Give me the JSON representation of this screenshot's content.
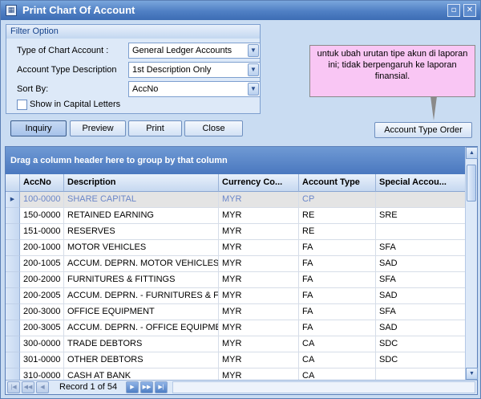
{
  "window": {
    "title": "Print Chart Of Account",
    "icon": "app-icon",
    "controls": [
      "restore-icon",
      "close-icon"
    ]
  },
  "filter": {
    "legend": "Filter Option",
    "type_label": "Type of Chart Account :",
    "type_value": "General Ledger Accounts",
    "desc_label": "Account Type Description",
    "desc_value": "1st Description Only",
    "sort_label": "Sort By:",
    "sort_value": "AccNo",
    "capital_label": "Show in Capital Letters",
    "capital_checked": false
  },
  "buttons": {
    "inquiry": "Inquiry",
    "preview": "Preview",
    "print": "Print",
    "close": "Close",
    "account_type_order": "Account Type Order"
  },
  "note": "untuk ubah urutan tipe akun di laporan ini; tidak berpengaruh ke laporan finansial.",
  "grid": {
    "group_hint": "Drag a column header here to group by that column",
    "columns": [
      "AccNo",
      "Description",
      "Currency Co...",
      "Account Type",
      "Special Accou..."
    ],
    "rows": [
      [
        "100-0000",
        "SHARE CAPITAL",
        "MYR",
        "CP",
        ""
      ],
      [
        "150-0000",
        "RETAINED EARNING",
        "MYR",
        "RE",
        "SRE"
      ],
      [
        "151-0000",
        "RESERVES",
        "MYR",
        "RE",
        ""
      ],
      [
        "200-1000",
        "MOTOR VEHICLES",
        "MYR",
        "FA",
        "SFA"
      ],
      [
        "200-1005",
        "ACCUM. DEPRN. MOTOR VEHICLES",
        "MYR",
        "FA",
        "SAD"
      ],
      [
        "200-2000",
        "FURNITURES & FITTINGS",
        "MYR",
        "FA",
        "SFA"
      ],
      [
        "200-2005",
        "ACCUM. DEPRN. - FURNITURES & FI...",
        "MYR",
        "FA",
        "SAD"
      ],
      [
        "200-3000",
        "OFFICE EQUIPMENT",
        "MYR",
        "FA",
        "SFA"
      ],
      [
        "200-3005",
        "ACCUM. DEPRN. - OFFICE EQUIPMENT",
        "MYR",
        "FA",
        "SAD"
      ],
      [
        "300-0000",
        "TRADE DEBTORS",
        "MYR",
        "CA",
        "SDC"
      ],
      [
        "301-0000",
        "OTHER DEBTORS",
        "MYR",
        "CA",
        "SDC"
      ],
      [
        "310-0000",
        "CASH AT BANK",
        "MYR",
        "CA",
        ""
      ]
    ],
    "selected_row": 0,
    "record_text": "Record 1 of 54"
  },
  "colors": {
    "accent": "#4f7fc4",
    "note_bg": "#f9c6f4",
    "selected_text": "#6a86c8"
  }
}
